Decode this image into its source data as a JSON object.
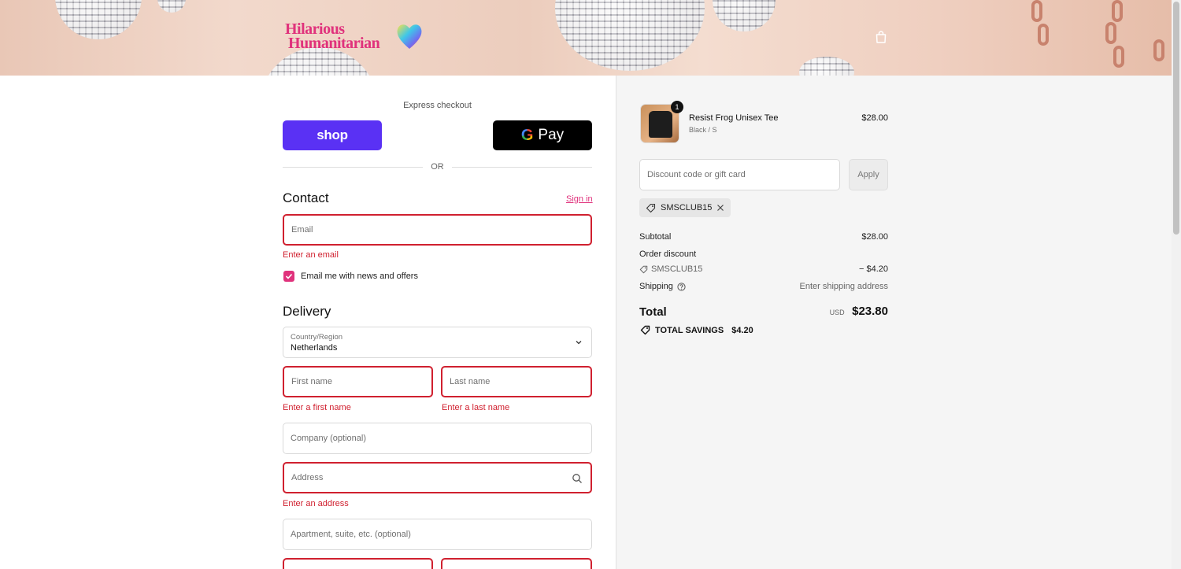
{
  "header": {
    "logo_line1": "Hilarious",
    "logo_line2": "Humanitarian",
    "cart_icon": "shopping-bag-icon"
  },
  "express": {
    "label": "Express checkout",
    "shop_label": "shop",
    "gpay_label": "Pay",
    "or_label": "OR"
  },
  "contact": {
    "title": "Contact",
    "signin_label": "Sign in",
    "email_placeholder": "Email",
    "email_error": "Enter an email",
    "newsletter_label": "Email me with news and offers",
    "newsletter_checked": true
  },
  "delivery": {
    "title": "Delivery",
    "country_label": "Country/Region",
    "country_value": "Netherlands",
    "first_name_placeholder": "First name",
    "first_name_error": "Enter a first name",
    "last_name_placeholder": "Last name",
    "last_name_error": "Enter a last name",
    "company_placeholder": "Company (optional)",
    "address_placeholder": "Address",
    "address_error": "Enter an address",
    "apartment_placeholder": "Apartment, suite, etc. (optional)"
  },
  "order": {
    "item": {
      "quantity": "1",
      "name": "Resist Frog Unisex Tee",
      "variant": "Black / S",
      "price": "$28.00"
    },
    "discount_placeholder": "Discount code or gift card",
    "apply_label": "Apply",
    "applied_code": "SMSCLUB15",
    "subtotal_label": "Subtotal",
    "subtotal_value": "$28.00",
    "order_discount_label": "Order discount",
    "discount_code": "SMSCLUB15",
    "discount_value": "− $4.20",
    "shipping_label": "Shipping",
    "shipping_value": "Enter shipping address",
    "total_label": "Total",
    "total_currency": "USD",
    "total_value": "$23.80",
    "savings_label": "TOTAL SAVINGS",
    "savings_value": "$4.20"
  },
  "colors": {
    "accent": "#e0327c",
    "error": "#d0202f",
    "shop_pay": "#5a31f4"
  }
}
